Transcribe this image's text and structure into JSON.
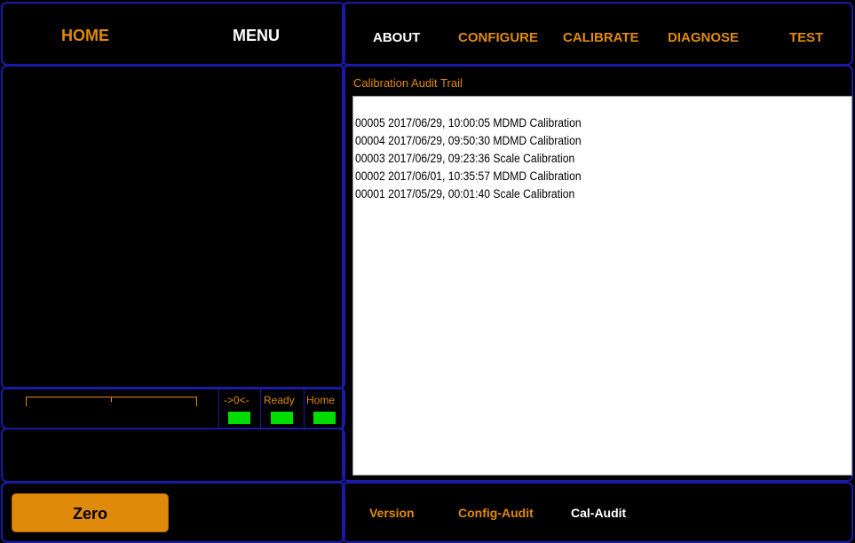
{
  "nav_left": {
    "home": "HOME",
    "menu": "MENU"
  },
  "nav_top": [
    "ABOUT",
    "CONFIGURE",
    "CALIBRATE",
    "DIAGNOSE",
    "TEST"
  ],
  "audit": {
    "title": "Calibration Audit Trail",
    "entries": [
      "00005 2017/06/29, 10:00:05 MDMD Calibration",
      "00004 2017/06/29, 09:50:30 MDMD Calibration",
      "00003 2017/06/29, 09:23:36 Scale Calibration",
      "00002 2017/06/01, 10:35:57 MDMD Calibration",
      "00001 2017/05/29, 00:01:40 Scale Calibration"
    ]
  },
  "indicators": [
    {
      "label": "->0<-",
      "status": "on"
    },
    {
      "label": "Ready",
      "status": "on"
    },
    {
      "label": "Home",
      "status": "on"
    }
  ],
  "zero_button": "Zero",
  "bottom_tabs": [
    "Version",
    "Config-Audit",
    "Cal-Audit"
  ],
  "colors": {
    "background": "#000000",
    "panel_border": "#1a1aa8",
    "accent_orange": "#e08a0c",
    "active_white": "#ffffff",
    "led_green": "#00dd00"
  }
}
